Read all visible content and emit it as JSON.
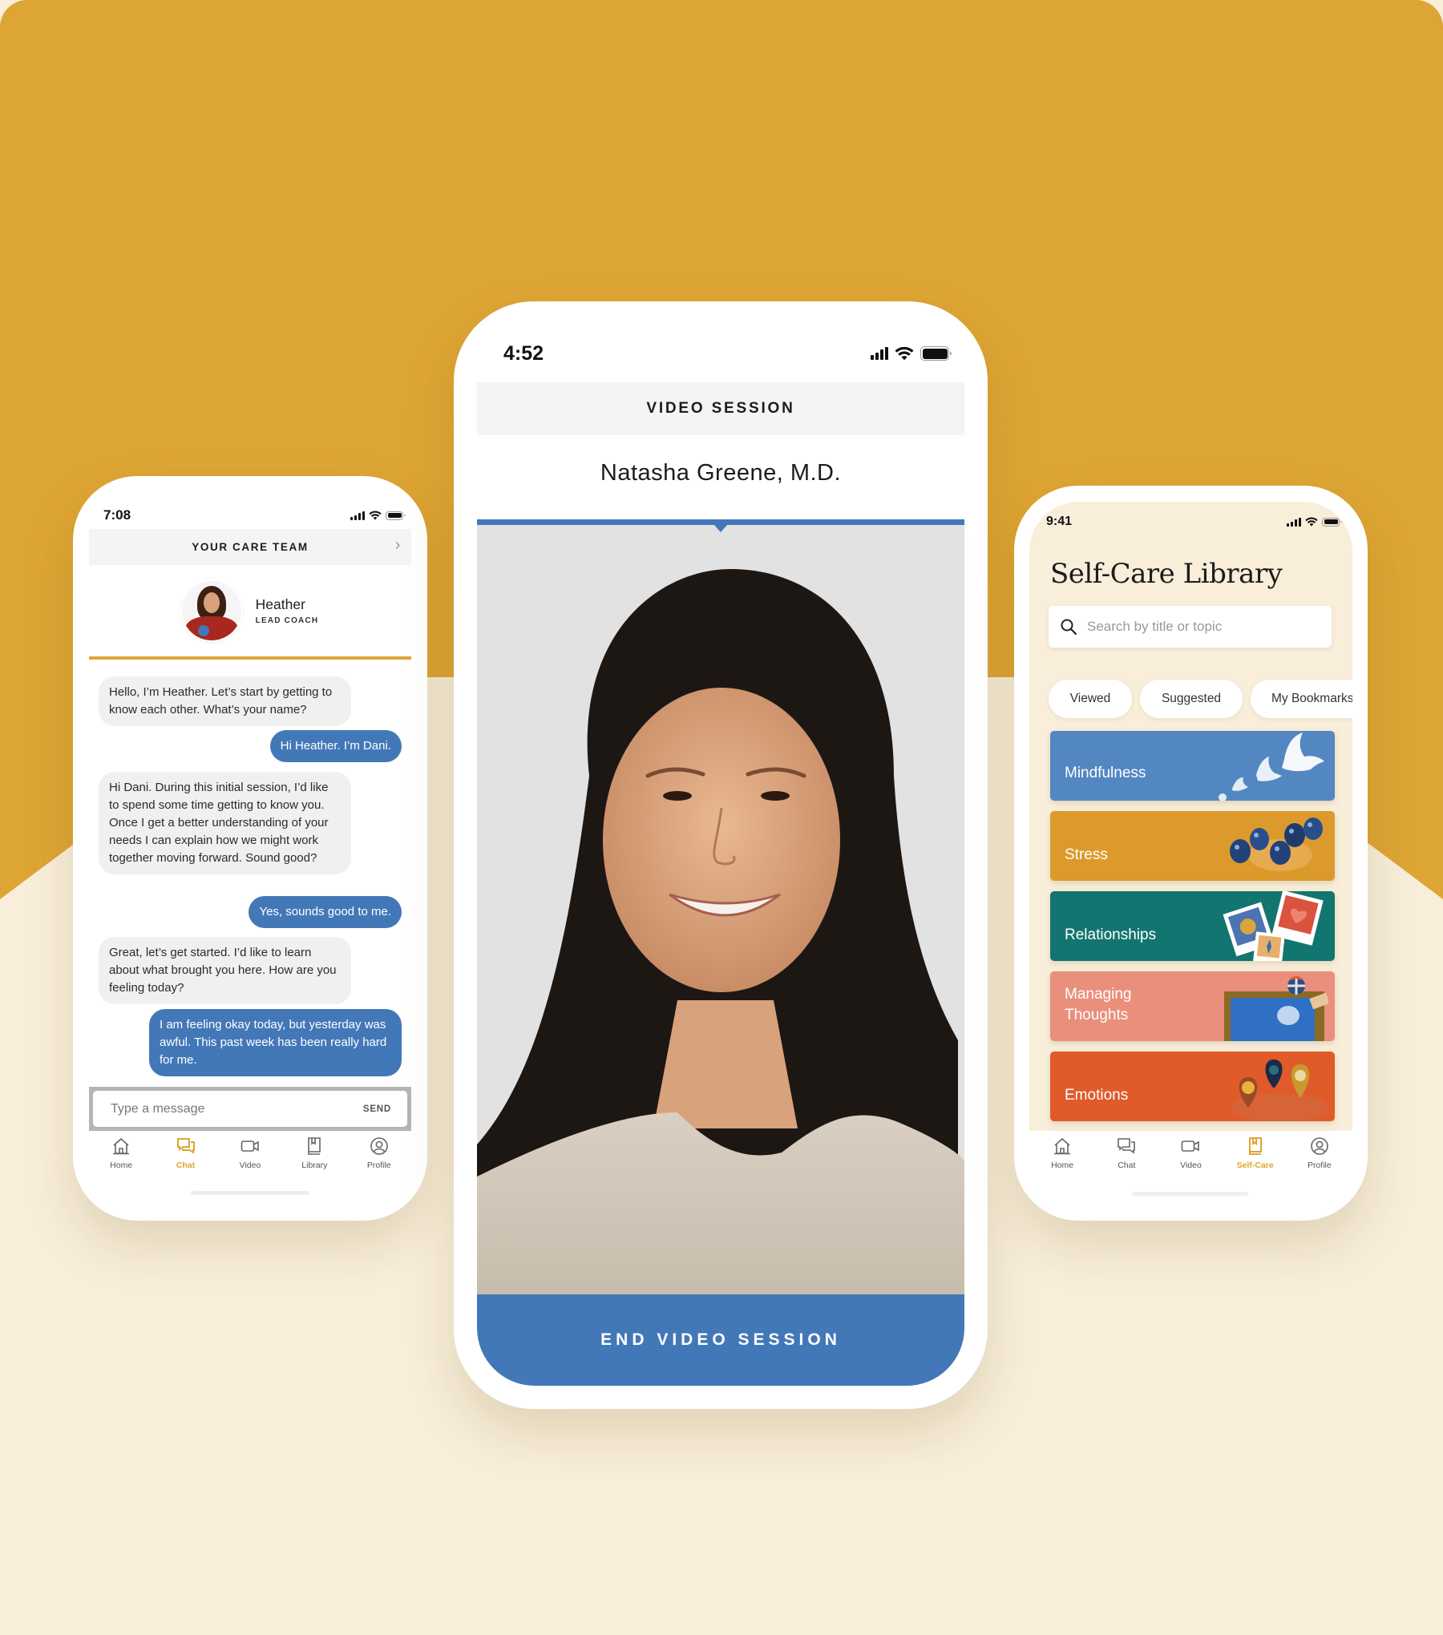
{
  "colors": {
    "brand_gold": "#DDA534",
    "cream": "#F8EEDA",
    "accent_blue": "#4378B8",
    "bubble_gray": "#F0F0F0"
  },
  "chat_phone": {
    "status_time": "7:08",
    "header_title": "YOUR CARE TEAM",
    "header_icon": "chevron-right-icon",
    "coach": {
      "name": "Heather",
      "role": "LEAD COACH",
      "status": "online"
    },
    "messages": [
      {
        "from": "coach",
        "text": "Hello, I’m Heather. Let’s start by getting to know each other. What’s your name?"
      },
      {
        "from": "user",
        "text": "Hi Heather. I’m Dani."
      },
      {
        "from": "coach",
        "text": "Hi Dani. During this initial session, I’d like to spend some time getting to know you. Once I get a better understanding of your needs I can explain how we might work together moving forward. Sound good?"
      },
      {
        "from": "user",
        "text": "Yes, sounds good to me."
      },
      {
        "from": "coach",
        "text": "Great, let’s get started. I’d like to learn about what brought you here. How are you feeling today?"
      },
      {
        "from": "user",
        "text": "I am feeling okay today, but yesterday was awful. This past week has been really hard for me."
      }
    ],
    "composer": {
      "placeholder": "Type a message",
      "send_label": "SEND"
    },
    "tabs": [
      {
        "label": "Home",
        "icon": "home-icon",
        "active": false
      },
      {
        "label": "Chat",
        "icon": "chat-icon",
        "active": true
      },
      {
        "label": "Video",
        "icon": "video-icon",
        "active": false
      },
      {
        "label": "Library",
        "icon": "library-icon",
        "active": false
      },
      {
        "label": "Profile",
        "icon": "profile-icon",
        "active": false
      }
    ]
  },
  "video_phone": {
    "status_time": "4:52",
    "header_title": "VIDEO SESSION",
    "doctor_name": "Natasha Greene, M.D.",
    "end_button_label": "END VIDEO SESSION"
  },
  "library_phone": {
    "status_time": "9:41",
    "title": "Self-Care Library",
    "search_placeholder": "Search by title or topic",
    "filters": [
      "Viewed",
      "Suggested",
      "My Bookmarks"
    ],
    "categories": [
      {
        "label": "Mindfulness",
        "color": "#5287C2",
        "art": "doves"
      },
      {
        "label": "Stress",
        "color": "#DC9A2C",
        "art": "balloons"
      },
      {
        "label": "Relationships",
        "color": "#137570",
        "art": "polaroids"
      },
      {
        "label": "Managing Thoughts",
        "color": "#E98F7C",
        "art": "picture-frame"
      },
      {
        "label": "Emotions",
        "color": "#E05A2A",
        "art": "map-pins"
      },
      {
        "label": "",
        "color": "#2D74C4",
        "art": ""
      }
    ],
    "tabs": [
      {
        "label": "Home",
        "icon": "home-icon",
        "active": false
      },
      {
        "label": "Chat",
        "icon": "chat-icon",
        "active": false
      },
      {
        "label": "Video",
        "icon": "video-icon",
        "active": false
      },
      {
        "label": "Self-Care",
        "icon": "library-icon",
        "active": true
      },
      {
        "label": "Profile",
        "icon": "profile-icon",
        "active": false
      }
    ]
  }
}
